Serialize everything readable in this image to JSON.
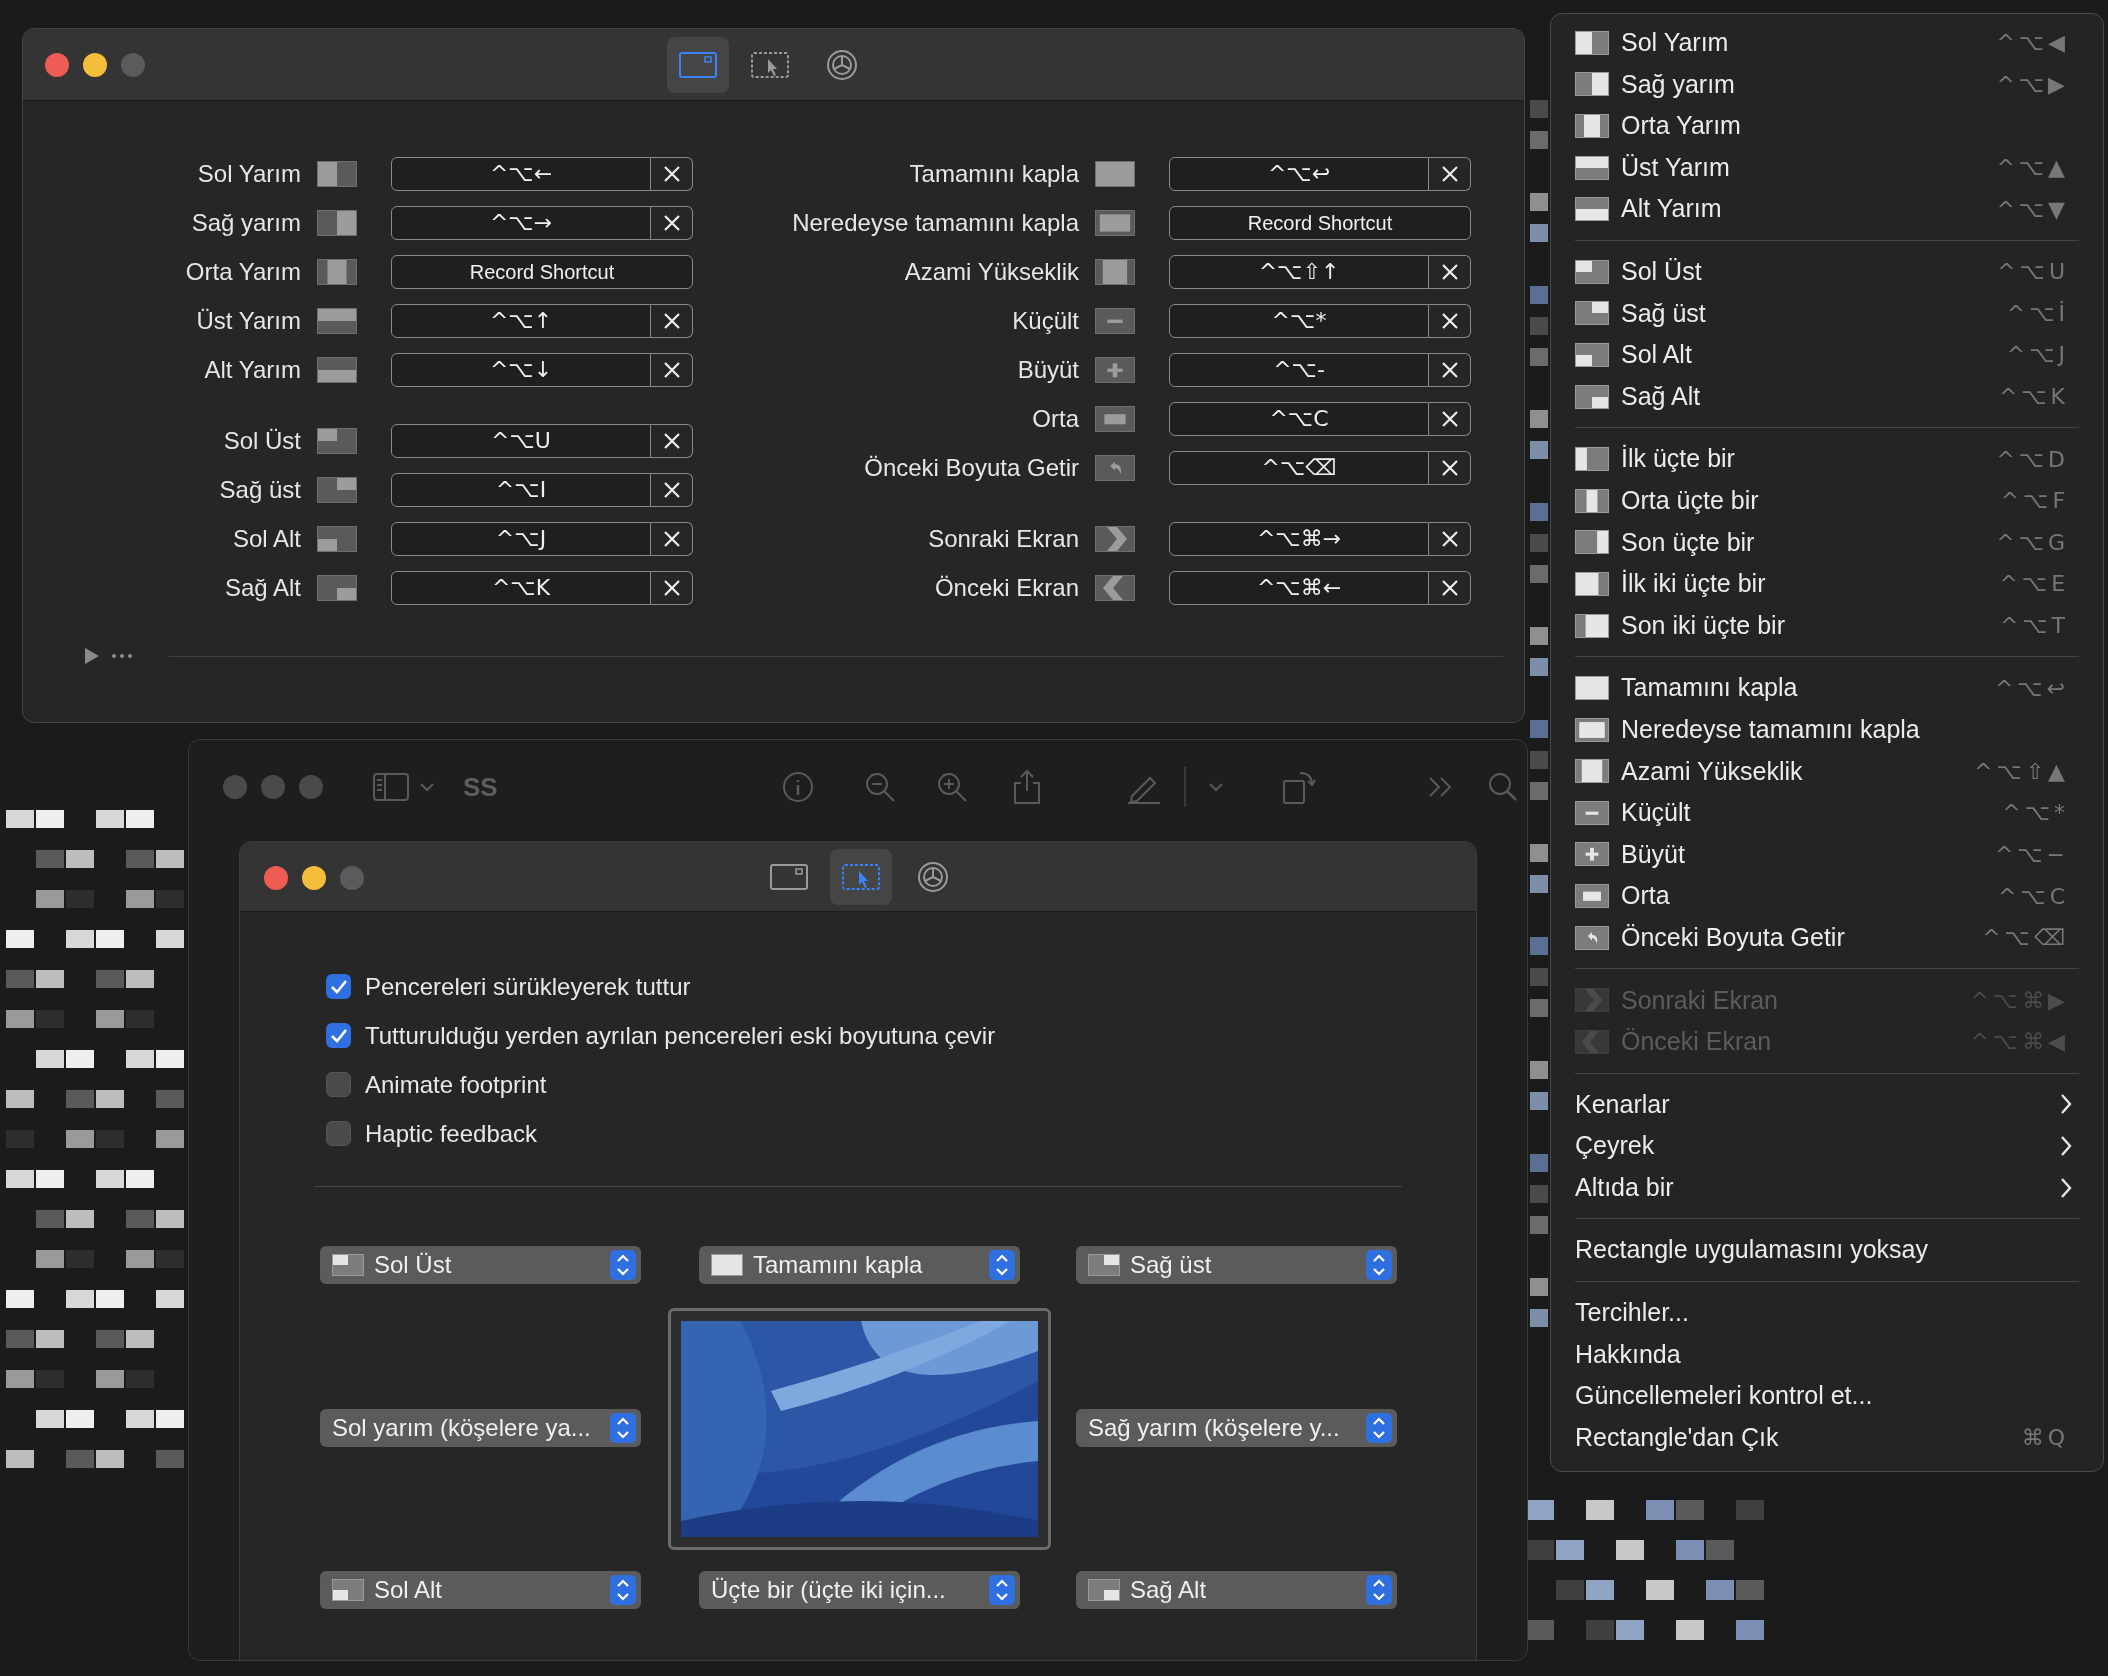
{
  "shortcuts_window": {
    "tabs": [
      {
        "kind": "shortcuts",
        "selected": true
      },
      {
        "kind": "snap_areas",
        "selected": false
      },
      {
        "kind": "settings",
        "selected": false
      }
    ],
    "left_groups": [
      [
        {
          "label": "Sol Yarım",
          "kind": "left_half",
          "shortcut": "^⌥←"
        },
        {
          "label": "Sağ yarım",
          "kind": "right_half",
          "shortcut": "^⌥→"
        },
        {
          "label": "Orta Yarım",
          "kind": "center_half",
          "record_button": "Record Shortcut"
        },
        {
          "label": "Üst Yarım",
          "kind": "top_half",
          "shortcut": "^⌥↑"
        },
        {
          "label": "Alt Yarım",
          "kind": "bottom_half",
          "shortcut": "^⌥↓"
        }
      ],
      [
        {
          "label": "Sol Üst",
          "kind": "top_left",
          "shortcut": "^⌥U"
        },
        {
          "label": "Sağ üst",
          "kind": "top_right",
          "shortcut": "^⌥I"
        },
        {
          "label": "Sol Alt",
          "kind": "bottom_left",
          "shortcut": "^⌥J"
        },
        {
          "label": "Sağ Alt",
          "kind": "bottom_right",
          "shortcut": "^⌥K"
        }
      ]
    ],
    "right_groups": [
      [
        {
          "label": "Tamamını kapla",
          "kind": "maximize",
          "shortcut": "^⌥↩"
        },
        {
          "label": "Neredeyse tamamını kapla",
          "kind": "almost_maximize",
          "record_button": "Record Shortcut"
        },
        {
          "label": "Azami Yükseklik",
          "kind": "maximize_height",
          "shortcut": "^⌥⇧↑"
        },
        {
          "label": "Küçült",
          "kind": "smaller",
          "shortcut": "^⌥*"
        },
        {
          "label": "Büyüt",
          "kind": "larger",
          "shortcut": "^⌥-"
        },
        {
          "label": "Orta",
          "kind": "center",
          "shortcut": "^⌥C"
        },
        {
          "label": "Önceki Boyuta Getir",
          "kind": "restore",
          "shortcut": "^⌥⌫"
        }
      ],
      [
        {
          "label": "Sonraki Ekran",
          "kind": "next_display",
          "shortcut": "^⌥⌘→"
        },
        {
          "label": "Önceki Ekran",
          "kind": "previous_display",
          "shortcut": "^⌥⌘←"
        }
      ]
    ]
  },
  "preview_window": {
    "title": "SS"
  },
  "snap_window": {
    "tabs": [
      {
        "kind": "shortcuts",
        "selected": false
      },
      {
        "kind": "snap_areas",
        "selected": true
      },
      {
        "kind": "settings",
        "selected": false
      }
    ],
    "options": [
      {
        "label": "Pencereleri sürükleyerek tuttur",
        "checked": true
      },
      {
        "label": "Tutturulduğu yerden ayrılan pencereleri eski boyutuna çevir",
        "checked": true
      },
      {
        "label": "Animate footprint",
        "checked": false
      },
      {
        "label": "Haptic feedback",
        "checked": false
      }
    ],
    "snap_areas": [
      {
        "label": "Sol Üst",
        "kind": "top_left"
      },
      {
        "label": "Tamamını kapla",
        "kind": "maximize"
      },
      {
        "label": "Sağ üst",
        "kind": "top_right"
      },
      {
        "label": "Sol yarım (köşelere ya..."
      },
      {
        "label": "Sağ yarım (köşelere y..."
      },
      {
        "label": "Sol Alt",
        "kind": "bottom_left"
      },
      {
        "label": "Üçte bir (üçte iki için..."
      },
      {
        "label": "Sağ Alt",
        "kind": "bottom_right"
      }
    ]
  },
  "menu": {
    "groups": [
      [
        {
          "label": "Sol Yarım",
          "kind": "left_half",
          "shortcut": "^⌥◀",
          "disabled": false,
          "submenu": false
        },
        {
          "label": "Sağ yarım",
          "kind": "right_half",
          "shortcut": "^⌥▶",
          "disabled": false,
          "submenu": false
        },
        {
          "label": "Orta Yarım",
          "kind": "center_half",
          "disabled": false,
          "submenu": false
        },
        {
          "label": "Üst Yarım",
          "kind": "top_half",
          "shortcut": "^⌥▲",
          "disabled": false,
          "submenu": false
        },
        {
          "label": "Alt Yarım",
          "kind": "bottom_half",
          "shortcut": "^⌥▼",
          "disabled": false,
          "submenu": false
        }
      ],
      [
        {
          "label": "Sol Üst",
          "kind": "top_left",
          "shortcut": "^⌥U",
          "disabled": false,
          "submenu": false
        },
        {
          "label": "Sağ üst",
          "kind": "top_right",
          "shortcut": "^⌥İ",
          "disabled": false,
          "submenu": false
        },
        {
          "label": "Sol Alt",
          "kind": "bottom_left",
          "shortcut": "^⌥J",
          "disabled": false,
          "submenu": false
        },
        {
          "label": "Sağ Alt",
          "kind": "bottom_right",
          "shortcut": "^⌥K",
          "disabled": false,
          "submenu": false
        }
      ],
      [
        {
          "label": "İlk üçte bir",
          "kind": "first_third",
          "shortcut": "^⌥D",
          "disabled": false,
          "submenu": false
        },
        {
          "label": "Orta üçte bir",
          "kind": "center_third",
          "shortcut": "^⌥F",
          "disabled": false,
          "submenu": false
        },
        {
          "label": "Son üçte bir",
          "kind": "last_third",
          "shortcut": "^⌥G",
          "disabled": false,
          "submenu": false
        },
        {
          "label": "İlk iki üçte bir",
          "kind": "first_two_thirds",
          "shortcut": "^⌥E",
          "disabled": false,
          "submenu": false
        },
        {
          "label": "Son iki üçte bir",
          "kind": "last_two_thirds",
          "shortcut": "^⌥T",
          "disabled": false,
          "submenu": false
        }
      ],
      [
        {
          "label": "Tamamını kapla",
          "kind": "maximize",
          "shortcut": "^⌥↩",
          "disabled": false,
          "submenu": false
        },
        {
          "label": "Neredeyse tamamını kapla",
          "kind": "almost_maximize",
          "disabled": false,
          "submenu": false
        },
        {
          "label": "Azami Yükseklik",
          "kind": "maximize_height",
          "shortcut": "^⌥⇧▲",
          "disabled": false,
          "submenu": false
        },
        {
          "label": "Küçült",
          "kind": "smaller",
          "shortcut": "^⌥*",
          "disabled": false,
          "submenu": false
        },
        {
          "label": "Büyüt",
          "kind": "larger",
          "shortcut": "^⌥−",
          "disabled": false,
          "submenu": false
        },
        {
          "label": "Orta",
          "kind": "center",
          "shortcut": "^⌥C",
          "disabled": false,
          "submenu": false
        },
        {
          "label": "Önceki Boyuta Getir",
          "kind": "restore",
          "shortcut": "^⌥⌫",
          "disabled": false,
          "submenu": false
        }
      ],
      [
        {
          "label": "Sonraki Ekran",
          "kind": "next_display",
          "shortcut": "^⌥⌘▶",
          "disabled": true,
          "submenu": false
        },
        {
          "label": "Önceki Ekran",
          "kind": "previous_display",
          "shortcut": "^⌥⌘◀",
          "disabled": true,
          "submenu": false
        }
      ],
      [
        {
          "label": "Kenarlar",
          "disabled": false,
          "submenu": true
        },
        {
          "label": "Çeyrek",
          "disabled": false,
          "submenu": true
        },
        {
          "label": "Altıda bir",
          "disabled": false,
          "submenu": true
        }
      ],
      [
        {
          "label": "Rectangle uygulamasını yoksay",
          "disabled": false,
          "submenu": false
        }
      ],
      [
        {
          "label": "Tercihler...",
          "disabled": false,
          "submenu": false
        },
        {
          "label": "Hakkında",
          "disabled": false,
          "submenu": false
        },
        {
          "label": "Güncellemeleri kontrol et...",
          "disabled": false,
          "submenu": false
        },
        {
          "label": "Rectangle'dan Çık",
          "shortcut": "⌘Q",
          "disabled": false,
          "submenu": false
        }
      ]
    ]
  }
}
